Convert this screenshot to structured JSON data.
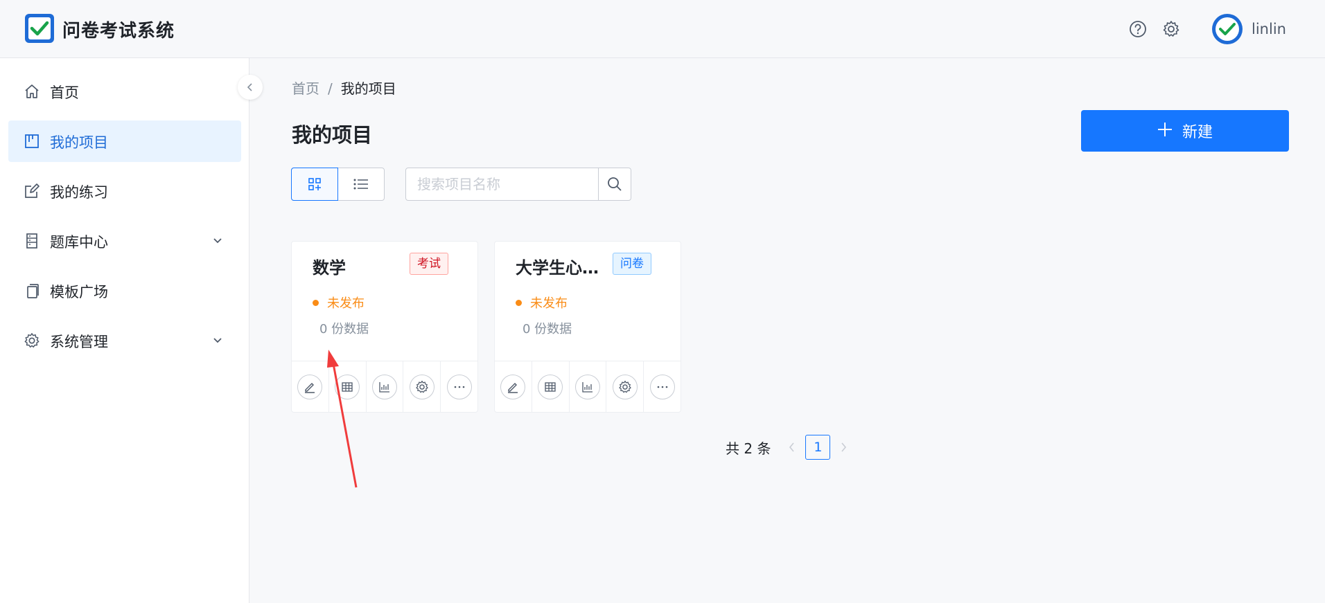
{
  "header": {
    "app_title": "问卷考试系统",
    "username": "linlin",
    "icons": [
      "help-icon",
      "settings-icon"
    ]
  },
  "sidebar": {
    "items": [
      {
        "label": "首页",
        "icon": "home-icon"
      },
      {
        "label": "我的项目",
        "icon": "project-icon",
        "active": true
      },
      {
        "label": "我的练习",
        "icon": "edit-icon"
      },
      {
        "label": "题库中心",
        "icon": "question-bank-icon",
        "expandable": true
      },
      {
        "label": "模板广场",
        "icon": "template-icon"
      },
      {
        "label": "系统管理",
        "icon": "gear-icon",
        "expandable": true
      }
    ]
  },
  "breadcrumb": {
    "home": "首页",
    "sep": "/",
    "current": "我的项目"
  },
  "main": {
    "title": "我的项目",
    "new_button": "新建",
    "search_placeholder": "搜索项目名称"
  },
  "cards": [
    {
      "name": "数学",
      "tag": "考试",
      "status": "未发布",
      "count": "0 份数据"
    },
    {
      "name": "大学生心理健康调查",
      "tag": "问卷",
      "status": "未发布",
      "count": "0 份数据"
    }
  ],
  "pagination": {
    "total_text": "共 2 条",
    "current": "1"
  },
  "colors": {
    "primary": "#1677ff",
    "warning": "#fa8c16",
    "annotation": "#f03c3c"
  }
}
